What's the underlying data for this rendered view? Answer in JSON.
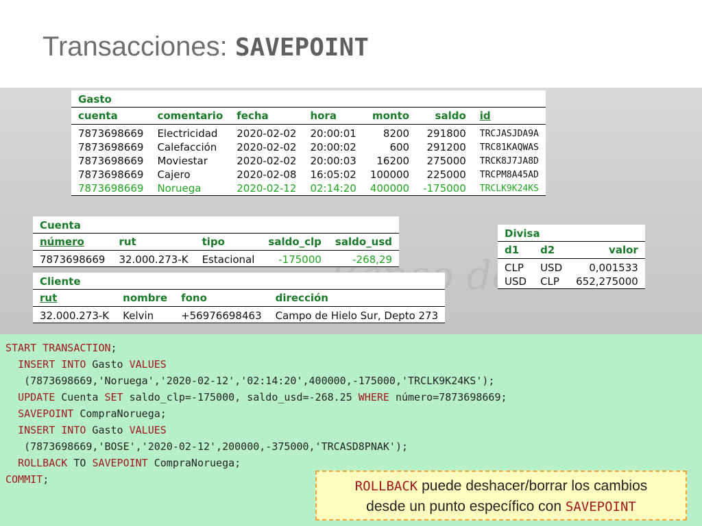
{
  "title": {
    "text": "Transacciones: ",
    "mono": "SAVEPOINT"
  },
  "watermark": "Banco de Chile",
  "gasto": {
    "caption": "Gasto",
    "headers": [
      "cuenta",
      "comentario",
      "fecha",
      "hora",
      "monto",
      "saldo",
      "id"
    ],
    "rows": [
      [
        "7873698669",
        "Electricidad",
        "2020-02-02",
        "20:00:01",
        "8200",
        "291800",
        "TRCJASJDA9A"
      ],
      [
        "7873698669",
        "Calefacción",
        "2020-02-02",
        "20:00:02",
        "600",
        "291200",
        "TRC81KAQWAS"
      ],
      [
        "7873698669",
        "Moviestar",
        "2020-02-02",
        "20:00:03",
        "16200",
        "275000",
        "TRCK8J7JA8D"
      ],
      [
        "7873698669",
        "Cajero",
        "2020-02-08",
        "16:05:02",
        "100000",
        "225000",
        "TRCPM8A45AD"
      ],
      [
        "7873698669",
        "Noruega",
        "2020-02-12",
        "02:14:20",
        "400000",
        "-175000",
        "TRCLK9K24KS"
      ]
    ]
  },
  "cuenta": {
    "caption": "Cuenta",
    "headers": [
      "número",
      "rut",
      "tipo",
      "saldo_clp",
      "saldo_usd"
    ],
    "rows": [
      [
        "7873698669",
        "32.000.273-K",
        "Estacional",
        "-175000",
        "-268,29"
      ]
    ]
  },
  "cliente": {
    "caption": "Cliente",
    "headers": [
      "rut",
      "nombre",
      "fono",
      "dirección"
    ],
    "rows": [
      [
        "32.000.273-K",
        "Kelvin",
        "+56976698463",
        "Campo de Hielo Sur, Depto 273"
      ]
    ]
  },
  "divisa": {
    "caption": "Divisa",
    "headers": [
      "d1",
      "d2",
      "valor"
    ],
    "rows": [
      [
        "CLP",
        "USD",
        "0,001533"
      ],
      [
        "USD",
        "CLP",
        "652,275000"
      ]
    ]
  },
  "code": [
    [
      {
        "k": true,
        "t": "START TRANSACTION"
      },
      {
        "t": ";"
      }
    ],
    [
      {
        "t": "  "
      },
      {
        "k": true,
        "t": "INSERT INTO"
      },
      {
        "t": " Gasto "
      },
      {
        "k": true,
        "t": "VALUES"
      }
    ],
    [
      {
        "t": "   (7873698669,'Noruega','2020-02-12','02:14:20',400000,-175000,'TRCLK9K24KS');"
      }
    ],
    [
      {
        "t": "  "
      },
      {
        "k": true,
        "t": "UPDATE"
      },
      {
        "t": " Cuenta "
      },
      {
        "k": true,
        "t": "SET"
      },
      {
        "t": " saldo_clp=-175000, saldo_usd=-268.25 "
      },
      {
        "k": true,
        "t": "WHERE"
      },
      {
        "t": " número=7873698669;"
      }
    ],
    [
      {
        "t": "  "
      },
      {
        "k": true,
        "t": "SAVEPOINT"
      },
      {
        "t": " CompraNoruega;"
      }
    ],
    [
      {
        "t": "  "
      },
      {
        "k": true,
        "t": "INSERT INTO"
      },
      {
        "t": " Gasto "
      },
      {
        "k": true,
        "t": "VALUES"
      }
    ],
    [
      {
        "t": "   (7873698669,'BOSE','2020-02-12',200000,-375000,'TRCASD8PNAK');"
      }
    ],
    [
      {
        "t": "  "
      },
      {
        "k": true,
        "t": "ROLLBACK"
      },
      {
        "t": " TO "
      },
      {
        "k": true,
        "t": "SAVEPOINT"
      },
      {
        "t": " CompraNoruega;"
      }
    ],
    [
      {
        "k": true,
        "t": "COMMIT"
      },
      {
        "t": ";"
      }
    ]
  ],
  "note": {
    "kw1": "ROLLBACK",
    "text1": " puede deshacer/borrar los cambios",
    "text2": "desde un punto específico con ",
    "kw2": "SAVEPOINT"
  },
  "colors": {
    "green_header": "#1a7a2a",
    "highlight_row": "#1fa51f",
    "keyword": "#a1161b",
    "code_bg": "#b7f0c8",
    "note_border": "#f2a335"
  }
}
